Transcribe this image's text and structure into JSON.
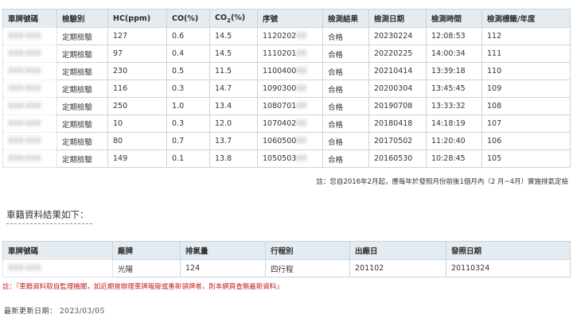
{
  "inspection": {
    "headers": [
      "車牌號碼",
      "檢驗別",
      "HC(ppm)",
      "CO(%)",
      "CO2(%)",
      "序號",
      "檢測結果",
      "檢測日期",
      "檢測時間",
      "檢測標籤/年度"
    ],
    "rows": [
      {
        "plate": "XXX-XXX",
        "type": "定期檢驗",
        "hc": "127",
        "co": "0.6",
        "co2": "14.5",
        "serial": "1120202",
        "serial_mask": "XX",
        "result": "合格",
        "date": "20230224",
        "time": "12:08:53",
        "label": "112"
      },
      {
        "plate": "XXX-XXX",
        "type": "定期檢驗",
        "hc": "97",
        "co": "0.4",
        "co2": "14.5",
        "serial": "1110201",
        "serial_mask": "XX",
        "result": "合格",
        "date": "20220225",
        "time": "14:00:34",
        "label": "111"
      },
      {
        "plate": "XXX-XXX",
        "type": "定期檢驗",
        "hc": "230",
        "co": "0.5",
        "co2": "11.5",
        "serial": "1100400",
        "serial_mask": "XX",
        "result": "合格",
        "date": "20210414",
        "time": "13:39:18",
        "label": "110"
      },
      {
        "plate": "XXX-XXX",
        "type": "定期檢驗",
        "hc": "116",
        "co": "0.3",
        "co2": "14.7",
        "serial": "1090300",
        "serial_mask": "XX",
        "result": "合格",
        "date": "20200304",
        "time": "13:45:45",
        "label": "109"
      },
      {
        "plate": "XXX-XXX",
        "type": "定期檢驗",
        "hc": "250",
        "co": "1.0",
        "co2": "13.4",
        "serial": "1080701",
        "serial_mask": "XX",
        "result": "合格",
        "date": "20190708",
        "time": "13:33:32",
        "label": "108"
      },
      {
        "plate": "XXX-XXX",
        "type": "定期檢驗",
        "hc": "10",
        "co": "0.3",
        "co2": "12.0",
        "serial": "1070402",
        "serial_mask": "XX",
        "result": "合格",
        "date": "20180418",
        "time": "14:18:19",
        "label": "107"
      },
      {
        "plate": "XXX-XXX",
        "type": "定期檢驗",
        "hc": "80",
        "co": "0.7",
        "co2": "13.7",
        "serial": "1060500",
        "serial_mask": "XX",
        "result": "合格",
        "date": "20170502",
        "time": "11:20:40",
        "label": "106"
      },
      {
        "plate": "XXX-XXX",
        "type": "定期檢驗",
        "hc": "149",
        "co": "0.1",
        "co2": "13.8",
        "serial": "1050503",
        "serial_mask": "XX",
        "result": "合格",
        "date": "20160530",
        "time": "10:28:45",
        "label": "105"
      }
    ],
    "note": "註：您自2016年2月起，應每年於發照月份前後1個月內（2 月~4月）實施排氣定檢"
  },
  "registration": {
    "title": "車籍資料結果如下：",
    "headers": [
      "車牌號碼",
      "廠牌",
      "排氣量",
      "行程別",
      "出廠日",
      "發照日期"
    ],
    "row": {
      "plate": "XXX-XXX",
      "brand": "光陽",
      "displacement": "124",
      "stroke": "四行程",
      "manufacture": "201102",
      "issue_date": "20110324"
    },
    "note": "註：『車籍資料取自監理機關，如近期曾辦理車牌報廢或重新領牌者，則本網頁查無最新資料』"
  },
  "last_updated": "最新更新日期： 2023/03/05",
  "colors": {
    "header_bg": "#e4ebf1",
    "border": "#c9d4de",
    "note_red": "#c0221f",
    "title_underline": "#6a8fb2"
  }
}
